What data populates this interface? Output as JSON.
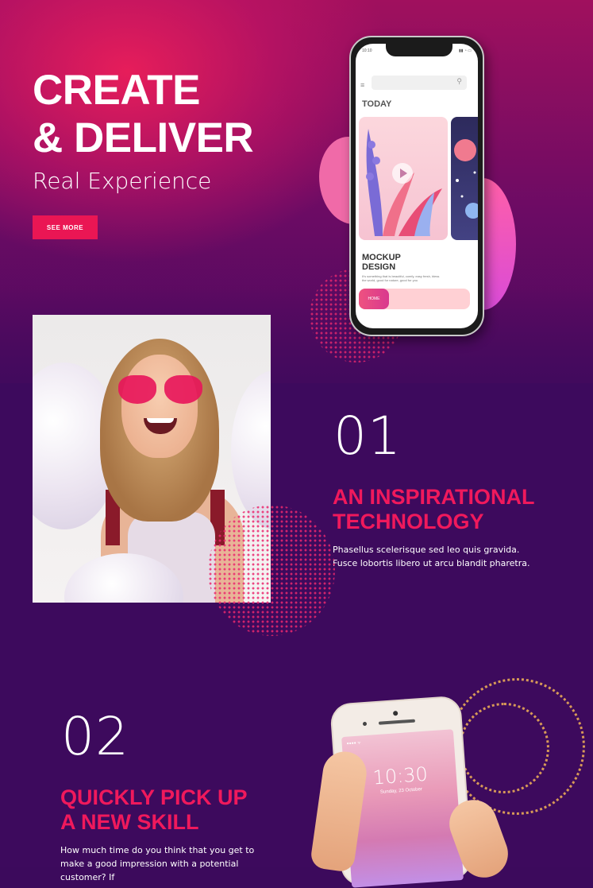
{
  "hero": {
    "title_line1": "CREATE",
    "title_line2": "& DELIVER",
    "subtitle": "Real Experience",
    "button_label": "SEE MORE"
  },
  "mockup_phone": {
    "status_time": "10:10",
    "status_icons": "▮▮ ◔ ▭",
    "menu_icon": "≡",
    "search_icon": "⚲",
    "section_label": "TODAY",
    "card_title_line1": "MOCKUP",
    "card_title_line2": "DESIGN",
    "card_desc": "It's something that is beautiful, comfy, easy fresh, bless the world, good for nature, good for you",
    "tab_home": "HOME"
  },
  "feature1": {
    "number": "01",
    "title_line1": "AN INSPIRATIONAL",
    "title_line2": "TECHNOLOGY",
    "description": "Phasellus scelerisque sed leo quis gravida. Fusce lobortis libero ut arcu blandit pharetra."
  },
  "feature2": {
    "number": "02",
    "title_line1": "QUICKLY PICK UP",
    "title_line2": "A NEW SKILL",
    "description": "How much time do you think that you get to make a good impression with a potential customer? If"
  },
  "lock_phone": {
    "status": "●●●● ᯤ",
    "time": "10:30",
    "date": "Sunday, 23 October"
  },
  "colors": {
    "accent": "#ea1654",
    "heading_pink": "#f0195c",
    "background_purple": "#3d0a5d",
    "ring_gold": "#d89a57"
  }
}
